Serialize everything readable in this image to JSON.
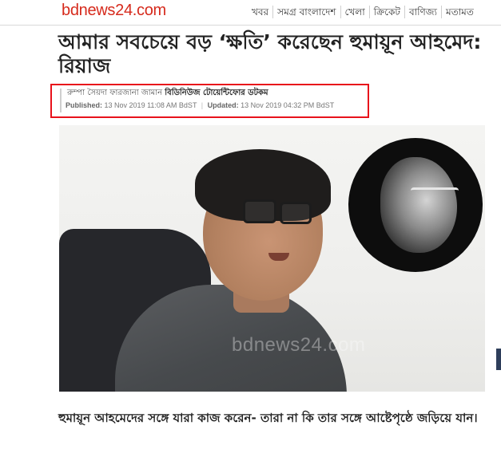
{
  "header": {
    "logo": "bdnews24.com",
    "nav": [
      "খবর",
      "সমগ্র বাংলাদেশ",
      "খেলা",
      "ক্রিকেট",
      "বাণিজ্য",
      "মতামত"
    ]
  },
  "article": {
    "headline": "আমার সবচেয়ে বড় ‘ক্ষতি’ করেছেন হুমায়ূন আহমেদ: রিয়াজ",
    "byline": {
      "authors": "রুম্পা সৈয়দা ফারজানা জামান",
      "organization": "বিডিনিউজ টোয়েন্টিফোর ডটকম"
    },
    "published_label": "Published:",
    "published": "13 Nov 2019 11:08 AM BdST",
    "updated_label": "Updated:",
    "updated": "13 Nov 2019 04:32 PM BdST",
    "photo_watermark": "bdnews24.com",
    "subtitle": "হুমায়ূন আহমেদের সঙ্গে যারা কাজ করেন- তারা না কি তার সঙ্গে আষ্টেপৃষ্ঠে জড়িয়ে যান।"
  },
  "colors": {
    "brand": "#d62a1c",
    "highlight_box": "#e8121b"
  }
}
